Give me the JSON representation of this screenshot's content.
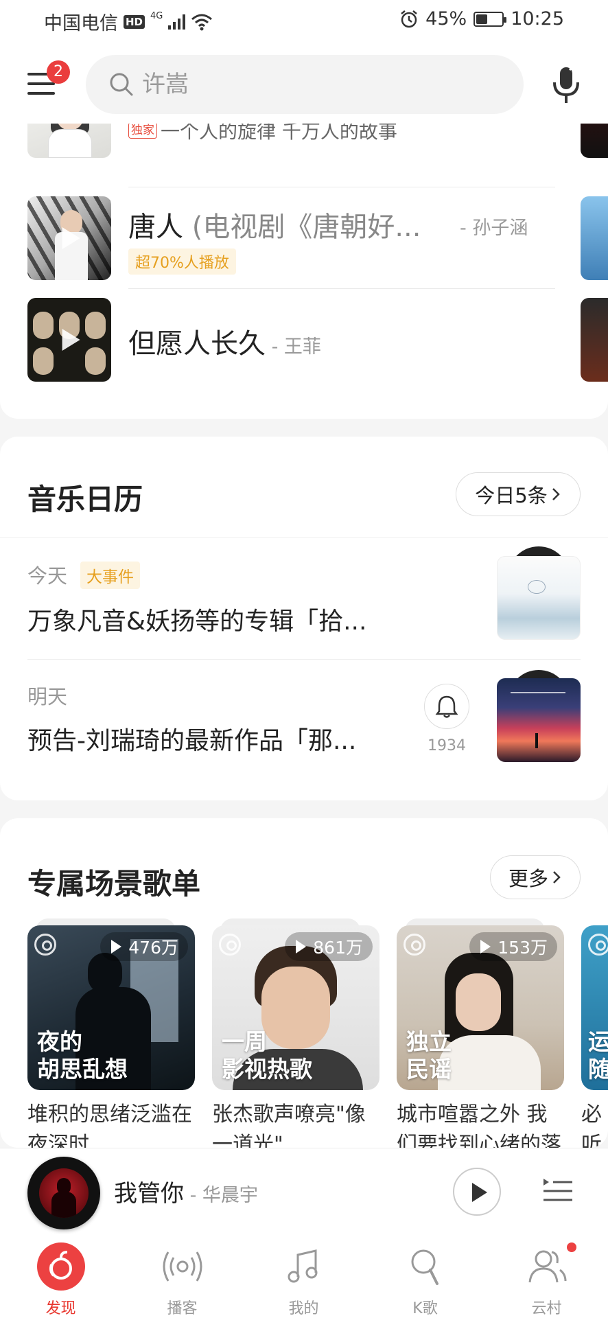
{
  "status_bar": {
    "carrier": "中国电信",
    "hd": "HD",
    "network": "4G",
    "battery_percent": "45%",
    "battery_level": 0.45,
    "time": "10:25"
  },
  "header": {
    "menu_badge": "2",
    "search_placeholder": "许嵩"
  },
  "songs": [
    {
      "title": "",
      "artist": "",
      "tag": "独家",
      "subtitle": "一个人的旋律 千万人的故事"
    },
    {
      "title": "唐人",
      "title_paren": " (电视剧《唐朝好...",
      "artist": "- 孙子涵",
      "tag": "超70%人播放"
    },
    {
      "title": "但愿人长久",
      "artist": " - 王菲"
    }
  ],
  "calendar": {
    "title": "音乐日历",
    "today_button": "今日5条",
    "items": [
      {
        "day": "今天",
        "tag": "大事件",
        "text": "万象凡音&妖扬等的专辑「拾..."
      },
      {
        "day": "明天",
        "text": "预告-刘瑞琦的最新作品「那...",
        "reminder_count": "1934"
      }
    ]
  },
  "playlists": {
    "title": "专属场景歌单",
    "more_button": "更多",
    "items": [
      {
        "count": "476万",
        "label_line1": "夜的",
        "label_line2": "胡思乱想",
        "desc": "堆积的思绪泛滥在夜深时"
      },
      {
        "count": "861万",
        "label_line1": "一周",
        "label_line2": "影视热歌",
        "desc": "张杰歌声嘹亮\"像一道光\""
      },
      {
        "count": "153万",
        "label_line1": "独立",
        "label_line2": "民谣",
        "desc": "城市喧嚣之外 我们要找到心绪的落脚"
      },
      {
        "label_line1": "运",
        "label_line2": "随",
        "desc": "必听今天"
      }
    ]
  },
  "player": {
    "song": "我管你",
    "artist": " - 华晨宇"
  },
  "tabs": [
    {
      "label": "发现",
      "icon": "discover-icon"
    },
    {
      "label": "播客",
      "icon": "podcast-icon"
    },
    {
      "label": "我的",
      "icon": "music-note-icon"
    },
    {
      "label": "K歌",
      "icon": "microphone-icon"
    },
    {
      "label": "云村",
      "icon": "community-icon"
    }
  ],
  "colors": {
    "brand_red": "#ec4141",
    "tag_gold": "#e6a020"
  }
}
